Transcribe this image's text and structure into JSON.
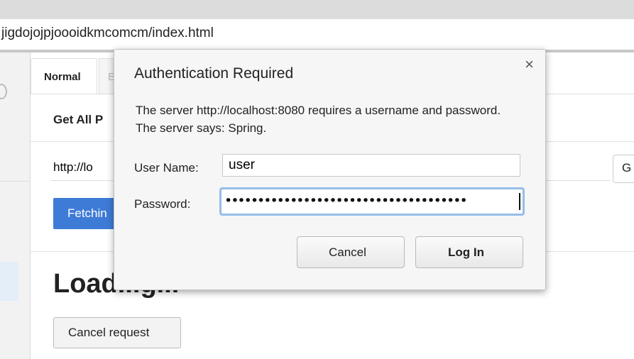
{
  "browser": {
    "address": "jigdojojpjoooidkmcomcm/index.html"
  },
  "page": {
    "tabs": [
      "Normal",
      "E"
    ],
    "section_title": "Get All P",
    "url_value": "http://lo",
    "go_label": "G",
    "fetch_label": "Fetchin",
    "loading_text": "Load...g...",
    "cancel_request_label": "Cancel request"
  },
  "dialog": {
    "title": "Authentication Required",
    "close_glyph": "×",
    "message": "The server http://localhost:8080 requires a username and password. The server says: Spring.",
    "username_label": "User Name:",
    "username_value": "user",
    "password_label": "Password:",
    "password_mask": "•••••••••••••••••••••••••••••••••••••",
    "cancel_label": "Cancel",
    "login_label": "Log In"
  },
  "colors": {
    "accent": "#3e7bd6",
    "focus_ring": "#96bde8"
  }
}
